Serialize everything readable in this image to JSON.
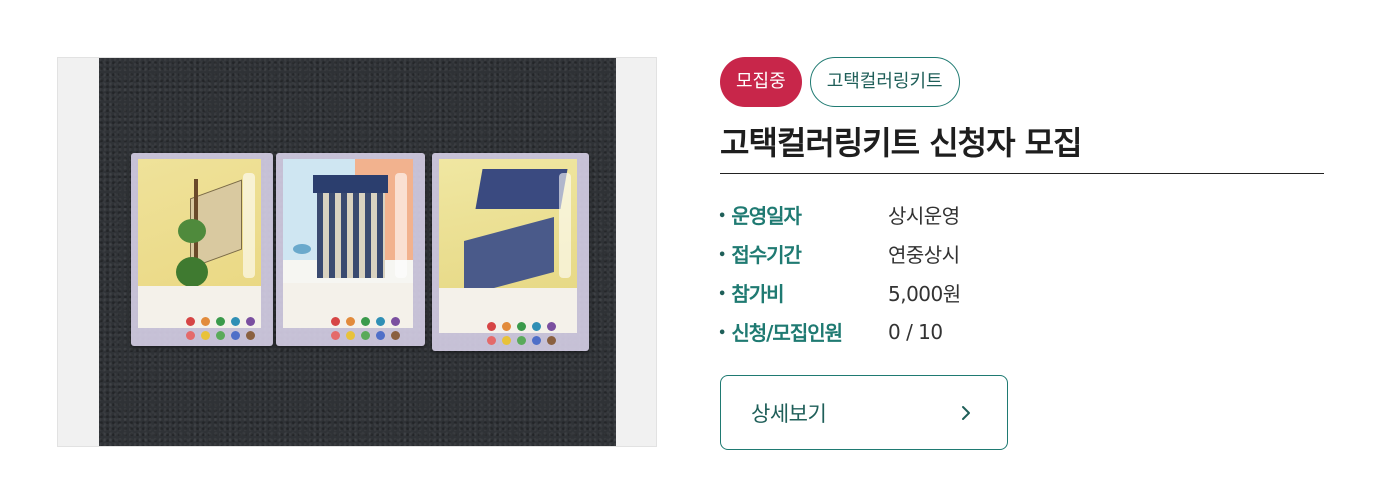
{
  "program": {
    "status_badge": "모집중",
    "category_badge": "고택컬러링키트",
    "title": "고택컬러링키트 신청자 모집"
  },
  "info": [
    {
      "label": "운영일자",
      "value": "상시운영"
    },
    {
      "label": "접수기간",
      "value": "연중상시"
    },
    {
      "label": "참가비",
      "value": "5,000원"
    },
    {
      "label": "신청/모집인원",
      "value": "0 / 10"
    }
  ],
  "actions": {
    "detail_label": "상세보기"
  },
  "colors": {
    "status": "#c8264a",
    "accent": "#1f7a72"
  },
  "icons": {
    "detail_arrow": "chevron-right-icon"
  }
}
